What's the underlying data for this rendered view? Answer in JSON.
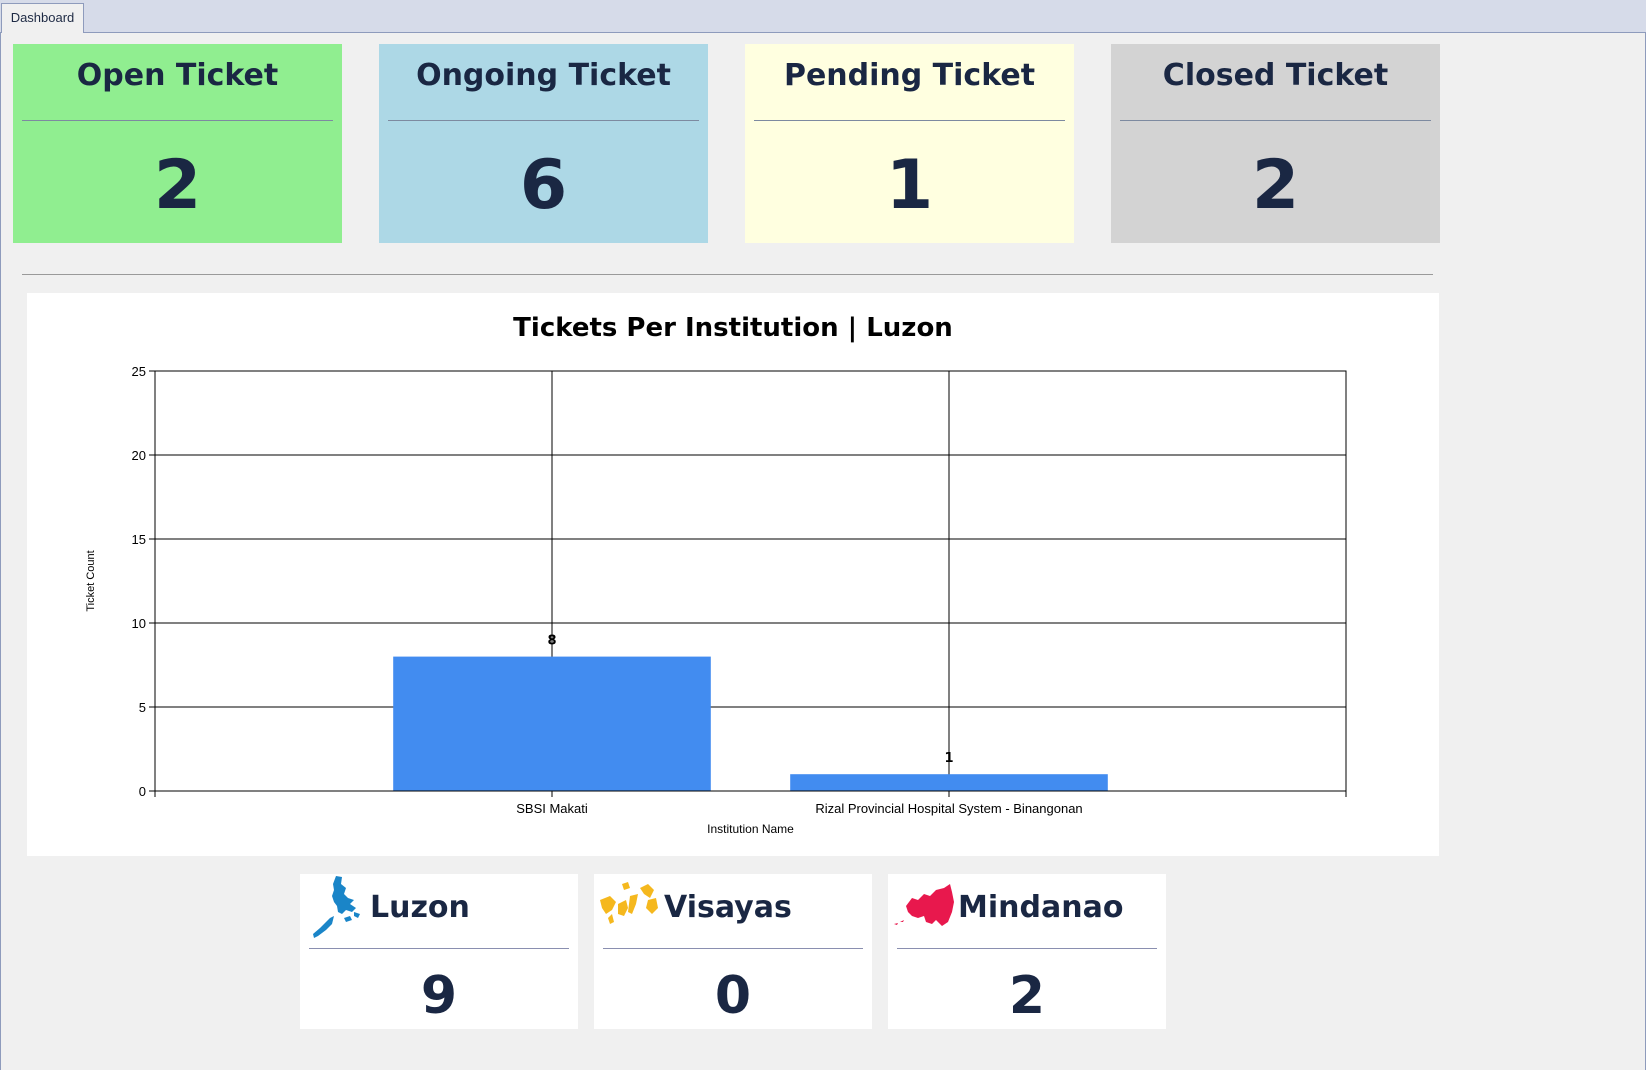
{
  "tabs": [
    {
      "label": "Dashboard"
    }
  ],
  "status_cards": [
    {
      "title": "Open Ticket",
      "value": "2",
      "color": "#90ee90"
    },
    {
      "title": "Ongoing Ticket",
      "value": "6",
      "color": "#add8e6"
    },
    {
      "title": "Pending Ticket",
      "value": "1",
      "color": "#ffffe0"
    },
    {
      "title": "Closed Ticket",
      "value": "2",
      "color": "#d3d3d3"
    }
  ],
  "chart_data": {
    "type": "bar",
    "title": "Tickets Per Institution | Luzon",
    "xlabel": "Institution Name",
    "ylabel": "Ticket Count",
    "categories": [
      "SBSI Makati",
      "Rizal Provincial Hospital System - Binangonan"
    ],
    "values": [
      8,
      1
    ],
    "data_labels": [
      "8",
      "1"
    ],
    "ylim": [
      0,
      25
    ],
    "yticks": [
      0,
      5,
      10,
      15,
      20,
      25
    ],
    "grid": true,
    "bar_color": "#428cf0"
  },
  "regions": [
    {
      "name": "Luzon",
      "value": "9",
      "icon": "luzon-map-icon",
      "color": "#1a85c8"
    },
    {
      "name": "Visayas",
      "value": "0",
      "icon": "visayas-map-icon",
      "color": "#f5b81e"
    },
    {
      "name": "Mindanao",
      "value": "2",
      "icon": "mindanao-map-icon",
      "color": "#e8184d"
    }
  ]
}
